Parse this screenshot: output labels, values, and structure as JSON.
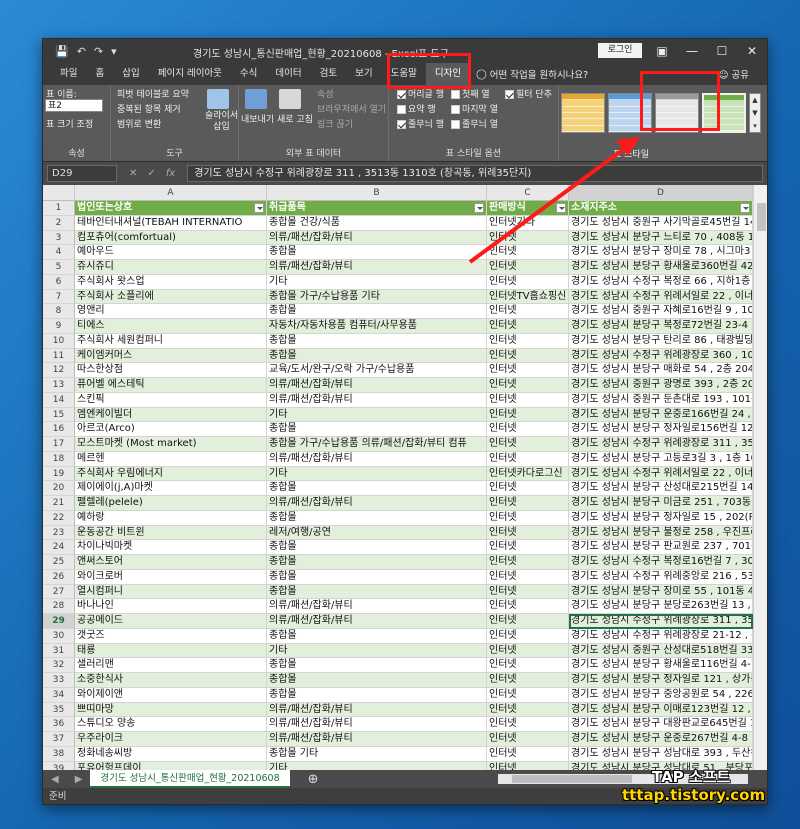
{
  "window": {
    "title": "경기도 성남시_통신판매업_현황_20210608  -  Excel",
    "context_group": "표 도구",
    "login_label": "로그인"
  },
  "tabs": [
    "파일",
    "홈",
    "삽입",
    "페이지 레이아웃",
    "수식",
    "데이터",
    "검토",
    "보기",
    "도움말",
    "디자인"
  ],
  "active_tab": "디자인",
  "tell_me": "어떤 작업을 원하시나요?",
  "share_label": "공유",
  "ribbon": {
    "props": {
      "name_label": "표 이름:",
      "name_value": "표2",
      "resize": "표 크기 조정",
      "label": "속성"
    },
    "tools": {
      "pivot": "피벗 테이블로 요약",
      "dedupe": "중복된 항목 제거",
      "convert": "범위로 변환",
      "slicer": "슬라이서\n삽입",
      "label": "도구"
    },
    "external": {
      "export": "내보내기",
      "refresh": "새로 고침",
      "props": "속성",
      "browser": "브라우저에서 열기",
      "unlink": "링크 끊기",
      "label": "외부 표 데이터"
    },
    "style_options": {
      "header_row": "머리글 행",
      "first_col": "첫째 열",
      "filter_button": "필터 단추",
      "total_row": "요약 행",
      "last_col": "마지막 열",
      "banded_rows": "줄무늬 행",
      "banded_cols": "줄무늬 열",
      "label": "표 스타일 옵션"
    },
    "styles_label": "표 스타일"
  },
  "formula_bar": {
    "name_box": "D29",
    "formula": "경기도 성남시 수정구 위례광장로 311 ,  3513동 1310호 (창곡동,  위례35단지)"
  },
  "columns": [
    "A",
    "B",
    "C",
    "D"
  ],
  "headers": [
    "법인또는상호",
    "취급품목",
    "판매방식",
    "소재지주소"
  ],
  "rows": [
    [
      "테바인터내셔널(TEBAH INTERNATIO",
      "종합몰 건강/식품",
      "인터넷기타",
      "경기도 성남시 중원구 사기막골로45번길 14 , 성남"
    ],
    [
      "컴포츄어(comfortual)",
      "의류/패션/잡화/뷰티",
      "인터넷",
      "경기도 성남시 분당구 느티로 70 ,  408동 1201호 ("
    ],
    [
      "예아우드",
      "종합몰",
      "인터넷",
      "경기도 성남시 분당구 장미로 78 ,  시그마3 1518호"
    ],
    [
      "쥬시쥬디",
      "의류/패션/잡화/뷰티",
      "인터넷",
      "경기도 성남시 분당구 황새울로360번길 42 ,  AK플"
    ],
    [
      "주식회사 왓스업",
      "기타",
      "인터넷",
      "경기도 성남시 수정구 복정로 66 ,  지하1층 (복정동"
    ],
    [
      "주식회사 소플리에",
      "종합몰 가구/수납용품 기타",
      "인터넷TV홈쇼핑신",
      "경기도 성남시 수정구 위례서일로 22 ,  이너매스우"
    ],
    [
      "영앤리",
      "종합몰",
      "인터넷",
      "경기도 성남시 중원구 자혜로16번길 9 ,  102동 903"
    ],
    [
      "티에스",
      "자동차/자동차용품 컴퓨터/사무용품",
      "인터넷",
      "경기도 성남시 분당구 복정로72번길 23-4 ,  B101호"
    ],
    [
      "주식회사 세원컴퍼니",
      "종합몰",
      "인터넷",
      "경기도 성남시 분당구 탄리로 86 ,  태광빌딩 2층 (탄"
    ],
    [
      "케이엠커머스",
      "종합몰",
      "인터넷",
      "경기도 성남시 수정구 위례광장로 360 ,  102동 807호 ("
    ],
    [
      "따스한상점",
      "교육/도서/완구/오락 가구/수납용품",
      "인터넷",
      "경기도 성남시 분당구 매화로 54 ,  2층 204호 A132"
    ],
    [
      "퓨어벨 에스테틱",
      "의류/패션/잡화/뷰티",
      "인터넷",
      "경기도 성남시 중원구 광명로 393 ,  2층 201호 (금"
    ],
    [
      "스킨픽",
      "의류/패션/잡화/뷰티",
      "인터넷",
      "경기도 성남시 중원구 둔촌대로 193 ,  101동 108호"
    ],
    [
      "엠엔케이빌더",
      "기타",
      "인터넷",
      "경기도 성남시 분당구 운중로166번길 24 ,  1층 (운"
    ],
    [
      "아르코(Arco)",
      "종합몰",
      "인터넷",
      "경기도 성남시 분당구 정자일로156번길 12 ,  1007"
    ],
    [
      "모스트마켓 (Most market)",
      "종합몰 가구/수납용품 의류/패션/잡화/뷰티 컴퓨",
      "인터넷",
      "경기도 성남시 수정구 위례광장로 311 ,  3507동 11"
    ],
    [
      "메르헨",
      "의류/패션/잡화/뷰티",
      "인터넷",
      "경기도 성남시 분당구 고등로3길 3 ,  1층 101호 (고"
    ],
    [
      "주식회사 우림에너지",
      "기타",
      "인터넷카다로그신",
      "경기도 성남시 수정구 위례서일로 22 ,  이너매스우"
    ],
    [
      "제이에이(j,A)마켓",
      "종합몰",
      "인터넷",
      "경기도 성남시 분당구 산성대로215번길 14-11 (신흥"
    ],
    [
      "펠렐레(pelele)",
      "의류/패션/잡화/뷰티",
      "인터넷",
      "경기도 성남시 분당구 미금로 251 ,  703동 401호 ("
    ],
    [
      "예하랑",
      "종합몰",
      "인터넷",
      "경기도 성남시 분당구 정자일로 15 ,  202(R162)호"
    ],
    [
      "운동공간 비트윈",
      "레저/여행/공연",
      "인터넷",
      "경기도 성남시 분당구 불정로 258 ,  우진프라자 4"
    ],
    [
      "차이나빅마켓",
      "종합몰",
      "인터넷",
      "경기도 성남시 분당구 판교원로 237 ,  701동 1203"
    ],
    [
      "앤써스토어",
      "종합몰",
      "인터넷",
      "경기도 성남시 수정구 복정로16번길 7 ,  302호 (복"
    ],
    [
      "와이크로버",
      "종합몰",
      "인터넷",
      "경기도 성남시 수정구 위례중앙로 216 ,  5303동 12"
    ],
    [
      "열시컴퍼니",
      "종합몰",
      "인터넷",
      "경기도 성남시 분당구 장미로 55 ,  101동 4층 1호"
    ],
    [
      "바나나인",
      "의류/패션/잡화/뷰티",
      "인터넷",
      "경기도 성남시 분당구 분당로263번길 13 ,  619동 7"
    ],
    [
      "공공메이드",
      "의류/패션/잡화/뷰티",
      "인터넷",
      "경기도 성남시 수정구 위례광장로 311 ,  3513동 13"
    ],
    [
      "갯굿즈",
      "종합몰",
      "인터넷",
      "경기도 성남시 수정구 위례광장로 21-12 ,  위례드"
    ],
    [
      "태룡",
      "기타",
      "인터넷",
      "경기도 성남시 중원구 산성대로518번길 33 ,  1층 9"
    ],
    [
      "샐러리맨",
      "종합몰",
      "인터넷",
      "경기도 성남시 분당구 황새울로116번길 4-1 (정자"
    ],
    [
      "소중한식사",
      "종합몰",
      "인터넷",
      "경기도 성남시 분당구 정자일로 121 ,  상가동 1층"
    ],
    [
      "와이제이앤",
      "종합몰",
      "인터넷",
      "경기도 성남시 분당구 중앙공원로 54 ,  226동 2902"
    ],
    [
      "쁘띠마망",
      "의류/패션/잡화/뷰티",
      "인터넷",
      "경기도 성남시 분당구 이매로123번길 12 ,  105동 3"
    ],
    [
      "스튜디오 양송",
      "의류/패션/잡화/뷰티",
      "인터넷",
      "경기도 성남시 분당구 대왕판교로645번길 12 ,  경"
    ],
    [
      "우주라이크",
      "의류/패션/잡화/뷰티",
      "인터넷",
      "경기도 성남시 분당구 운중로267번길 4-8 ,  301호"
    ],
    [
      "정화네송씨방",
      "종합몰 기타",
      "인터넷",
      "경기도 성남시 분당구 성남대로 393 ,  두산위브파"
    ],
    [
      "포유어헝프데이",
      "기타",
      "인터넷",
      "경기도 성남시 분당구 성남대로 51 ,  분당포스빌오"
    ],
    [
      "로티스코마티에셔",
      "기타",
      "인터넷",
      "경기도 성남시 분당구 성남대로 172 ,  포러니어이"
    ]
  ],
  "selected_row": 29,
  "sheet_tab": "경기도 성남시_통신판매업_현황_20210608",
  "status": "준비",
  "watermark": {
    "line1": "TAP 소프트",
    "line2": "tttap.tistory.com"
  }
}
